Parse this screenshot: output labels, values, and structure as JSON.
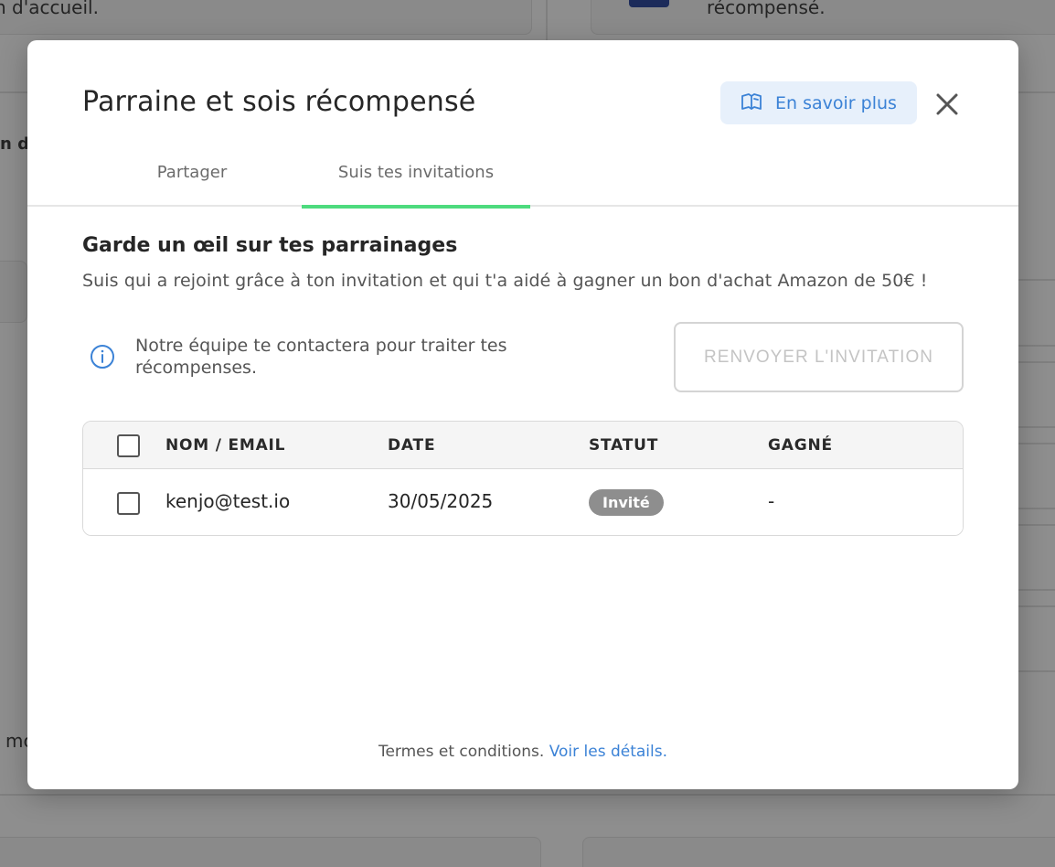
{
  "background": {
    "top_left_text": "n d'accueil.",
    "top_right_text": "récompensé.",
    "left_partial_1": "n d",
    "left_partial_2": "mc"
  },
  "modal": {
    "title": "Parraine et sois récompensé",
    "learn_more_label": "En savoir plus",
    "tabs": [
      {
        "label": "Partager",
        "active": false
      },
      {
        "label": "Suis tes invitations",
        "active": true
      }
    ],
    "section_title": "Garde un œil sur tes parrainages",
    "section_subtitle": "Suis qui a rejoint grâce à ton invitation et qui t'a aidé à gagner un bon d'achat Amazon de 50€ !",
    "info_text": "Notre équipe te contactera pour traiter tes récompenses.",
    "resend_button": "RENVOYER L'INVITATION",
    "table": {
      "columns": [
        "NOM / EMAIL",
        "DATE",
        "STATUT",
        "GAGNÉ"
      ],
      "rows": [
        {
          "email": "kenjo@test.io",
          "date": "30/05/2025",
          "status": "Invité",
          "earned": "-"
        }
      ]
    },
    "footer_text": "Termes et conditions.",
    "footer_link": "Voir les détails."
  },
  "colors": {
    "accent_green": "#4ddb7e",
    "link_blue": "#3b82d6",
    "status_badge": "#8e8e8e"
  }
}
